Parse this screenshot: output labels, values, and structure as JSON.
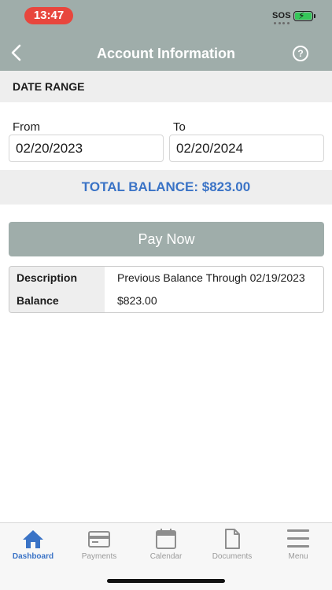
{
  "status_bar": {
    "time": "13:47",
    "carrier": "SOS"
  },
  "nav": {
    "title": "Account Information",
    "help_symbol": "?"
  },
  "date_range": {
    "heading": "DATE RANGE",
    "from_label": "From",
    "from_value": "02/20/2023",
    "to_label": "To",
    "to_value": "02/20/2024"
  },
  "summary": {
    "total_balance": "TOTAL BALANCE: $823.00"
  },
  "actions": {
    "pay_now": "Pay Now"
  },
  "details": [
    {
      "key": "Description",
      "value": "Previous Balance Through 02/19/2023"
    },
    {
      "key": "Balance",
      "value": "$823.00"
    }
  ],
  "tabs": [
    {
      "label": "Dashboard",
      "icon": "home-icon",
      "active": true
    },
    {
      "label": "Payments",
      "icon": "credit-card-icon",
      "active": false
    },
    {
      "label": "Calendar",
      "icon": "calendar-icon",
      "active": false
    },
    {
      "label": "Documents",
      "icon": "document-icon",
      "active": false
    },
    {
      "label": "Menu",
      "icon": "menu-icon",
      "active": false
    }
  ],
  "colors": {
    "header": "#9fadaa",
    "accent": "#3a73c6",
    "time_pill": "#e8463d"
  }
}
